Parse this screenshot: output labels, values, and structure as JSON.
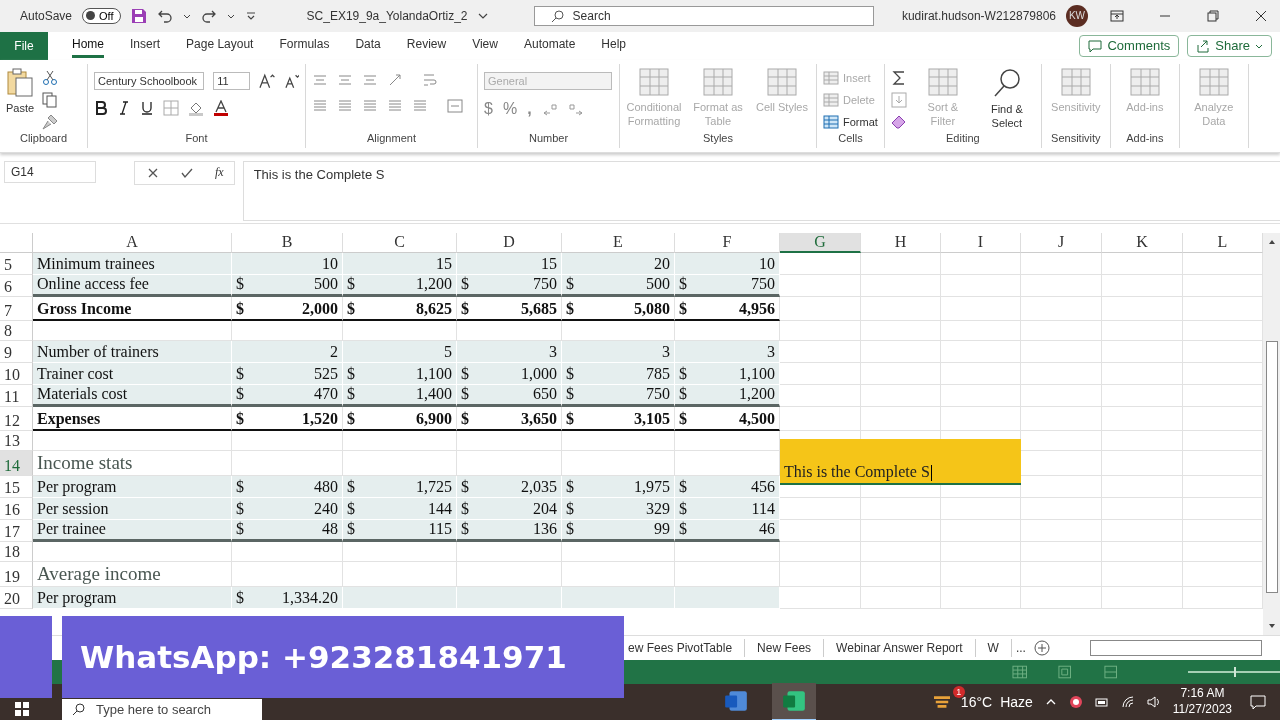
{
  "title_bar": {
    "autosave_label": "AutoSave",
    "autosave": {
      "on": false,
      "label": "Off"
    },
    "file_name": "SC_EX19_9a_YolandaOrtiz_2",
    "search_placeholder": "Search",
    "user": "kudirat.hudson-W212879806",
    "avatar": "KW"
  },
  "menu_tabs": [
    {
      "label": "File",
      "kind": "file",
      "selected": false
    },
    {
      "label": "Home",
      "kind": "tab",
      "selected": true
    },
    {
      "label": "Insert",
      "kind": "tab",
      "selected": false
    },
    {
      "label": "Page Layout",
      "kind": "tab",
      "selected": false
    },
    {
      "label": "Formulas",
      "kind": "tab",
      "selected": false
    },
    {
      "label": "Data",
      "kind": "tab",
      "selected": false
    },
    {
      "label": "Review",
      "kind": "tab",
      "selected": false
    },
    {
      "label": "View",
      "kind": "tab",
      "selected": false
    },
    {
      "label": "Automate",
      "kind": "tab",
      "selected": false
    },
    {
      "label": "Help",
      "kind": "tab",
      "selected": false
    }
  ],
  "comments_button": "Comments",
  "share_button": "Share",
  "ribbon": {
    "clipboard": {
      "label": "Clipboard",
      "paste": "Paste"
    },
    "font": {
      "label": "Font",
      "family": "Century Schoolbook",
      "size": "11"
    },
    "alignment": {
      "label": "Alignment"
    },
    "number": {
      "label": "Number",
      "format": "General",
      "currency": "$",
      "percent": "%",
      "comma": ","
    },
    "groups": [
      {
        "label": "Styles",
        "buttons": [
          {
            "label": "Conditional Formatting",
            "kind": "large",
            "disabled": true
          },
          {
            "label": "Format as Table",
            "kind": "large",
            "disabled": true
          },
          {
            "label": "Cell Styles",
            "kind": "large",
            "disabled": true
          }
        ]
      },
      {
        "label": "Cells",
        "buttons": [
          {
            "label": "Insert",
            "kind": "small",
            "disabled": true
          },
          {
            "label": "Delete",
            "kind": "small",
            "disabled": true
          },
          {
            "label": "Format",
            "kind": "small",
            "disabled": false
          }
        ]
      },
      {
        "label": "Editing",
        "buttons": [
          {
            "kind": "tools"
          },
          {
            "label": "Sort & Filter",
            "kind": "large",
            "disabled": true
          },
          {
            "label": "Find & Select",
            "kind": "search",
            "disabled": false
          }
        ]
      },
      {
        "label": "Sensitivity",
        "buttons": [
          {
            "label": "Sensitivity",
            "kind": "large",
            "disabled": true
          }
        ]
      },
      {
        "label": "Add-ins",
        "buttons": [
          {
            "label": "Add-ins",
            "kind": "large",
            "disabled": true
          }
        ]
      },
      {
        "buttons": [
          {
            "label": "Analyze Data",
            "kind": "large",
            "disabled": true
          }
        ]
      }
    ]
  },
  "formula_bar": {
    "name_box": "G14",
    "fx": "fx",
    "formula": "This is the Complete S"
  },
  "sheet": {
    "columns": [
      {
        "label": "A",
        "selected": false
      },
      {
        "label": "B",
        "selected": false
      },
      {
        "label": "C",
        "selected": false
      },
      {
        "label": "D",
        "selected": false
      },
      {
        "label": "E",
        "selected": false
      },
      {
        "label": "F",
        "selected": false
      },
      {
        "label": "G",
        "selected": true
      },
      {
        "label": "H",
        "selected": false
      },
      {
        "label": "I",
        "selected": false
      },
      {
        "label": "J",
        "selected": false
      },
      {
        "label": "K",
        "selected": false
      },
      {
        "label": "L",
        "selected": false
      }
    ],
    "rows": [
      {
        "num": "5",
        "kind": "band",
        "selected": false,
        "rule": false,
        "label": "Minimum trainees",
        "cells": [
          {
            "value": "10"
          },
          {
            "value": "15"
          },
          {
            "value": "15"
          },
          {
            "value": "20"
          },
          {
            "value": "10"
          }
        ]
      },
      {
        "num": "6",
        "kind": "band",
        "selected": false,
        "rule": true,
        "label": "Online access fee",
        "cells": [
          {
            "currency": "$",
            "value": "500"
          },
          {
            "currency": "$",
            "value": "1,200"
          },
          {
            "currency": "$",
            "value": "750"
          },
          {
            "currency": "$",
            "value": "500"
          },
          {
            "currency": "$",
            "value": "750"
          }
        ]
      },
      {
        "num": "7",
        "kind": "total",
        "selected": false,
        "rule": false,
        "label": "Gross Income",
        "cells": [
          {
            "currency": "$",
            "value": "2,000"
          },
          {
            "currency": "$",
            "value": "8,625"
          },
          {
            "currency": "$",
            "value": "5,685"
          },
          {
            "currency": "$",
            "value": "5,080"
          },
          {
            "currency": "$",
            "value": "4,956"
          }
        ]
      },
      {
        "num": "8",
        "kind": "blank",
        "selected": false,
        "rule": false
      },
      {
        "num": "9",
        "kind": "band",
        "selected": false,
        "rule": false,
        "label": "Number of trainers",
        "cells": [
          {
            "value": "2"
          },
          {
            "value": "5"
          },
          {
            "value": "3"
          },
          {
            "value": "3"
          },
          {
            "value": "3"
          }
        ]
      },
      {
        "num": "10",
        "kind": "band",
        "selected": false,
        "rule": false,
        "label": "Trainer cost",
        "cells": [
          {
            "currency": "$",
            "value": "525"
          },
          {
            "currency": "$",
            "value": "1,100"
          },
          {
            "currency": "$",
            "value": "1,000"
          },
          {
            "currency": "$",
            "value": "785"
          },
          {
            "currency": "$",
            "value": "1,100"
          }
        ]
      },
      {
        "num": "11",
        "kind": "band",
        "selected": false,
        "rule": true,
        "label": "Materials cost",
        "cells": [
          {
            "currency": "$",
            "value": "470"
          },
          {
            "currency": "$",
            "value": "1,400"
          },
          {
            "currency": "$",
            "value": "650"
          },
          {
            "currency": "$",
            "value": "750"
          },
          {
            "currency": "$",
            "value": "1,200"
          }
        ]
      },
      {
        "num": "12",
        "kind": "total",
        "selected": false,
        "rule": false,
        "label": "Expenses",
        "cells": [
          {
            "currency": "$",
            "value": "1,520"
          },
          {
            "currency": "$",
            "value": "6,900"
          },
          {
            "currency": "$",
            "value": "3,650"
          },
          {
            "currency": "$",
            "value": "3,105"
          },
          {
            "currency": "$",
            "value": "4,500"
          }
        ]
      },
      {
        "num": "13",
        "kind": "blank",
        "selected": false,
        "rule": false
      },
      {
        "num": "14",
        "kind": "heading",
        "selected": true,
        "rule": false,
        "label": "Income stats"
      },
      {
        "num": "15",
        "kind": "band",
        "selected": false,
        "rule": false,
        "label": "Per program",
        "cells": [
          {
            "currency": "$",
            "value": "480"
          },
          {
            "currency": "$",
            "value": "1,725"
          },
          {
            "currency": "$",
            "value": "2,035"
          },
          {
            "currency": "$",
            "value": "1,975"
          },
          {
            "currency": "$",
            "value": "456"
          }
        ]
      },
      {
        "num": "16",
        "kind": "band",
        "selected": false,
        "rule": false,
        "label": "Per session",
        "cells": [
          {
            "currency": "$",
            "value": "240"
          },
          {
            "currency": "$",
            "value": "144"
          },
          {
            "currency": "$",
            "value": "204"
          },
          {
            "currency": "$",
            "value": "329"
          },
          {
            "currency": "$",
            "value": "114"
          }
        ]
      },
      {
        "num": "17",
        "kind": "band",
        "selected": false,
        "rule": true,
        "label": "Per trainee",
        "cells": [
          {
            "currency": "$",
            "value": "48"
          },
          {
            "currency": "$",
            "value": "115"
          },
          {
            "currency": "$",
            "value": "136"
          },
          {
            "currency": "$",
            "value": "99"
          },
          {
            "currency": "$",
            "value": "46"
          }
        ]
      },
      {
        "num": "18",
        "kind": "blank",
        "selected": false,
        "rule": false
      },
      {
        "num": "19",
        "kind": "heading",
        "selected": false,
        "rule": false,
        "label": "Average income"
      },
      {
        "num": "20",
        "kind": "band",
        "selected": false,
        "rule": false,
        "label": "Per program",
        "cells": [
          {
            "currency": "$",
            "value": "1,334.20"
          }
        ]
      }
    ],
    "editing_text": "This is the Complete S"
  },
  "sheet_tabs": [
    {
      "label": "ew Fees PivotTable",
      "selected": false
    },
    {
      "label": "New Fees",
      "selected": false
    },
    {
      "label": "Webinar Answer Report",
      "selected": false
    },
    {
      "label": "W",
      "selected": false
    }
  ],
  "more_tabs": "...",
  "zoom_slider": {
    "level": 0.5
  },
  "taskbar": {
    "search_placeholder": "Type here to search",
    "weather_badge": "1",
    "temperature": "16°C",
    "weather": "Haze",
    "time": "7:16 AM",
    "date": "11/27/2023"
  },
  "banner": "WhatsApp: +923281841971"
}
